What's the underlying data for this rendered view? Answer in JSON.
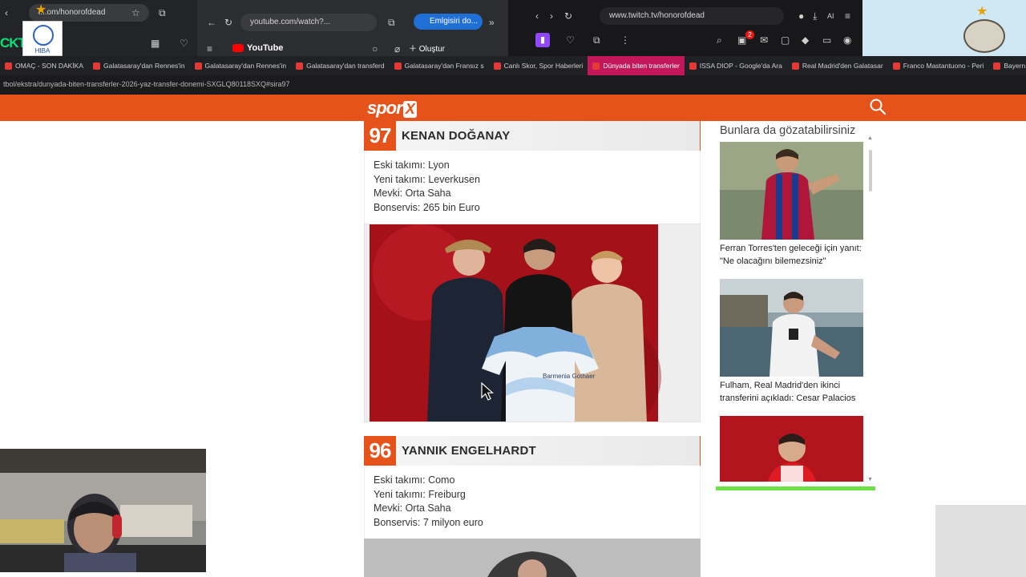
{
  "browser": {
    "window_a": {
      "url": "i...om/honorofdead"
    },
    "window_b": {
      "url": "youtube.com/watch?...",
      "pill": "Emlgisiri do...",
      "youtube_label": "YouTube",
      "create_label": "Oluştur"
    },
    "window_c": {
      "url": "www.twitch.tv/honorofdead",
      "notification_count": "2",
      "ai_label": "AI"
    },
    "logos": {
      "hiba_label": "HIBA",
      "kt_label": "CKT",
      "seal_label": "HONOR OF DEAD"
    },
    "bookmarks": [
      {
        "label": "OMAÇ - SON DAKİKA",
        "active": false
      },
      {
        "label": "Galatasaray'dan Rennes'in",
        "active": false
      },
      {
        "label": "Galatasaray'dan Rennes'in",
        "active": false
      },
      {
        "label": "Galatasaray'dan transferd",
        "active": false
      },
      {
        "label": "Galatasaray'dan Fransız s",
        "active": false
      },
      {
        "label": "Canlı Skor, Spor Haberleri",
        "active": false
      },
      {
        "label": "Dünyada biten transferler",
        "active": true
      },
      {
        "label": "ISSA DIOP - Google'da Ara",
        "active": false
      },
      {
        "label": "Real Madrid'den Galatasar",
        "active": false
      },
      {
        "label": "Franco Mastantuono - Peri",
        "active": false
      },
      {
        "label": "Bayern",
        "active": false
      }
    ],
    "page_url": "tbol/ekstra/dunyada-biten-transferler-2026-yaz-transfer-donemi-SXGLQ80118SXQ#sira97"
  },
  "site": {
    "logo_text": "spor",
    "logo_x": "X",
    "accent_color": "#e5531a"
  },
  "entries": [
    {
      "rank": "97",
      "name": "KENAN DOĞANAY",
      "lines": [
        "Eski takımı: Lyon",
        "Yeni takımı: Leverkusen",
        "Mevki: Orta Saha",
        "Bonservis: 265 bin Euro"
      ],
      "jersey_sponsor": "Barmenia Gothaer"
    },
    {
      "rank": "96",
      "name": "YANNIK ENGELHARDT",
      "lines": [
        "Eski takımı: Como",
        "Yeni takımı: Freiburg",
        "Mevki: Orta Saha",
        "Bonservis: 7 milyon euro"
      ]
    }
  ],
  "sidebar": {
    "title": "Bunlara da gözatabilirsiniz",
    "cards": [
      {
        "caption": "Ferran Torres'ten geleceği için yanıt: \"Ne olacağını bilemezsiniz\""
      },
      {
        "caption": "Fulham, Real Madrid'den ikinci transferini açıkladı: Cesar Palacios"
      },
      {
        "caption": ""
      }
    ]
  }
}
